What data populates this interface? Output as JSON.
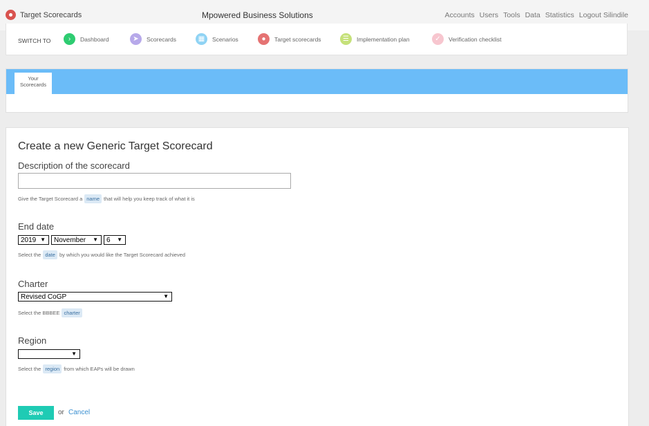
{
  "brand": {
    "name": "Target Scorecards",
    "color": "#d9534f"
  },
  "app_title": "Mpowered Business Solutions",
  "topnav": [
    "Accounts",
    "Users",
    "Tools",
    "Data",
    "Statistics",
    "Logout Silindile"
  ],
  "switchbar": {
    "label": "SWITCH TO",
    "items": [
      {
        "label": "Dashboard",
        "icon": "chevron-right-icon",
        "color": "#2ecc71"
      },
      {
        "label": "Scorecards",
        "icon": "send-icon",
        "color": "#b7a9ea"
      },
      {
        "label": "Scenarios",
        "icon": "map-icon",
        "color": "#8fd3f4"
      },
      {
        "label": "Target scorecards",
        "icon": "pin-icon",
        "color": "#e57373"
      },
      {
        "label": "Implementation plan",
        "icon": "list-icon",
        "color": "#c5e17a"
      },
      {
        "label": "Verification checklist",
        "icon": "check-icon",
        "color": "#f7c6cf"
      }
    ]
  },
  "tabs": [
    {
      "label": "Your Scorecards"
    }
  ],
  "form": {
    "title": "Create a new Generic Target Scorecard",
    "description": {
      "label": "Description of the scorecard",
      "value": "",
      "hint_before": "Give the Target Scorecard a",
      "hint_pill": "name",
      "hint_after": "that will help you keep track of what it is"
    },
    "end_date": {
      "label": "End date",
      "year": "2019",
      "month": "November",
      "day": "6",
      "hint_before": "Select the",
      "hint_pill": "date",
      "hint_after": "by which you would like the Target Scorecard achieved"
    },
    "charter": {
      "label": "Charter",
      "value": "Revised CoGP",
      "hint_before": "Select the BBBEE",
      "hint_pill": "charter",
      "hint_after": ""
    },
    "region": {
      "label": "Region",
      "value": "",
      "hint_before": "Select the",
      "hint_pill": "region",
      "hint_after": "from which EAPs will be drawn"
    },
    "save_label": "Save",
    "or_text": "or",
    "cancel_label": "Cancel"
  }
}
